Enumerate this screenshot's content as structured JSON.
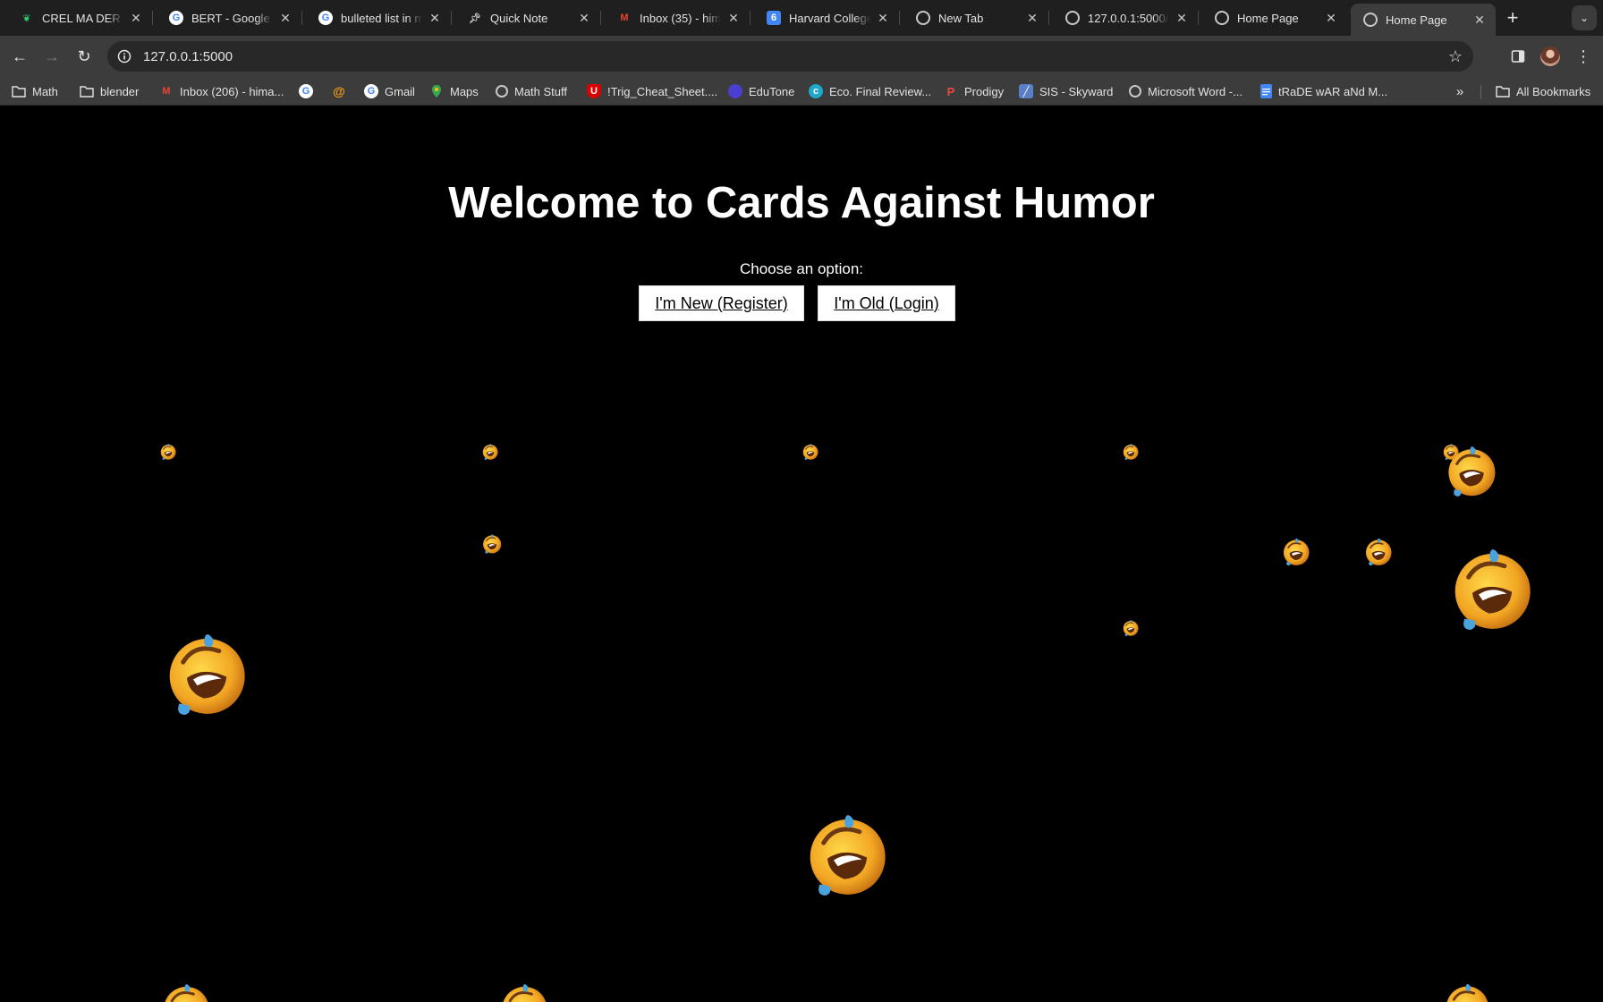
{
  "browser": {
    "tabs": [
      {
        "title": "CREL MA DER Pa",
        "icon": "leaf-icon",
        "color": "#2ecc71",
        "active": false
      },
      {
        "title": "BERT - Google S",
        "icon": "google-icon",
        "color": "#4285f4",
        "active": false
      },
      {
        "title": "bulleted list in m",
        "icon": "google-icon",
        "color": "#4285f4",
        "active": false
      },
      {
        "title": "Quick Note",
        "icon": "pin-icon",
        "color": "#c8c8c8",
        "active": false
      },
      {
        "title": "Inbox (35) - hima",
        "icon": "gmail-icon",
        "color": "#ea4335",
        "active": false
      },
      {
        "title": "Harvard College",
        "icon": "calendar-icon",
        "color": "#4285f4",
        "active": false
      },
      {
        "title": "New Tab",
        "icon": "chrome-icon",
        "color": "#c8c8c8",
        "active": false
      },
      {
        "title": "127.0.0.1:5000/r",
        "icon": "globe-icon",
        "color": "#c8c8c8",
        "active": false
      },
      {
        "title": "Home Page",
        "icon": "globe-icon",
        "color": "#c8c8c8",
        "active": false
      },
      {
        "title": "Home Page",
        "icon": "globe-icon",
        "color": "#c8c8c8",
        "active": true
      }
    ],
    "url": "127.0.0.1:5000",
    "bookmarks": [
      {
        "label": "Math",
        "icon": "folder-icon"
      },
      {
        "label": "blender",
        "icon": "folder-icon"
      },
      {
        "label": "Inbox (206) - hima...",
        "icon": "gmail-icon"
      },
      {
        "label": "",
        "icon": "google-icon"
      },
      {
        "label": "",
        "icon": "swirl-icon"
      },
      {
        "label": "Gmail",
        "icon": "google-icon"
      },
      {
        "label": "Maps",
        "icon": "maps-pin-icon"
      },
      {
        "label": "Math Stuff",
        "icon": "globe-icon"
      },
      {
        "label": "!Trig_Cheat_Sheet....",
        "icon": "shield-icon"
      },
      {
        "label": "EduTone",
        "icon": "circle-icon"
      },
      {
        "label": "Eco. Final Review...",
        "icon": "c-logo-icon"
      },
      {
        "label": "Prodigy",
        "icon": "prodigy-icon"
      },
      {
        "label": "SIS - Skyward",
        "icon": "skyward-icon"
      },
      {
        "label": "Microsoft Word -...",
        "icon": "globe-icon"
      },
      {
        "label": "tRaDE wAR aNd M...",
        "icon": "docs-icon"
      }
    ],
    "all_bookmarks_label": "All Bookmarks"
  },
  "page": {
    "title": "Welcome to Cards Against Humor",
    "prompt": "Choose an option:",
    "register_label": "I'm New (Register)",
    "login_label": "I'm Old (Login)",
    "decoration_icon": "rolling-on-floor-laughing-icon"
  }
}
